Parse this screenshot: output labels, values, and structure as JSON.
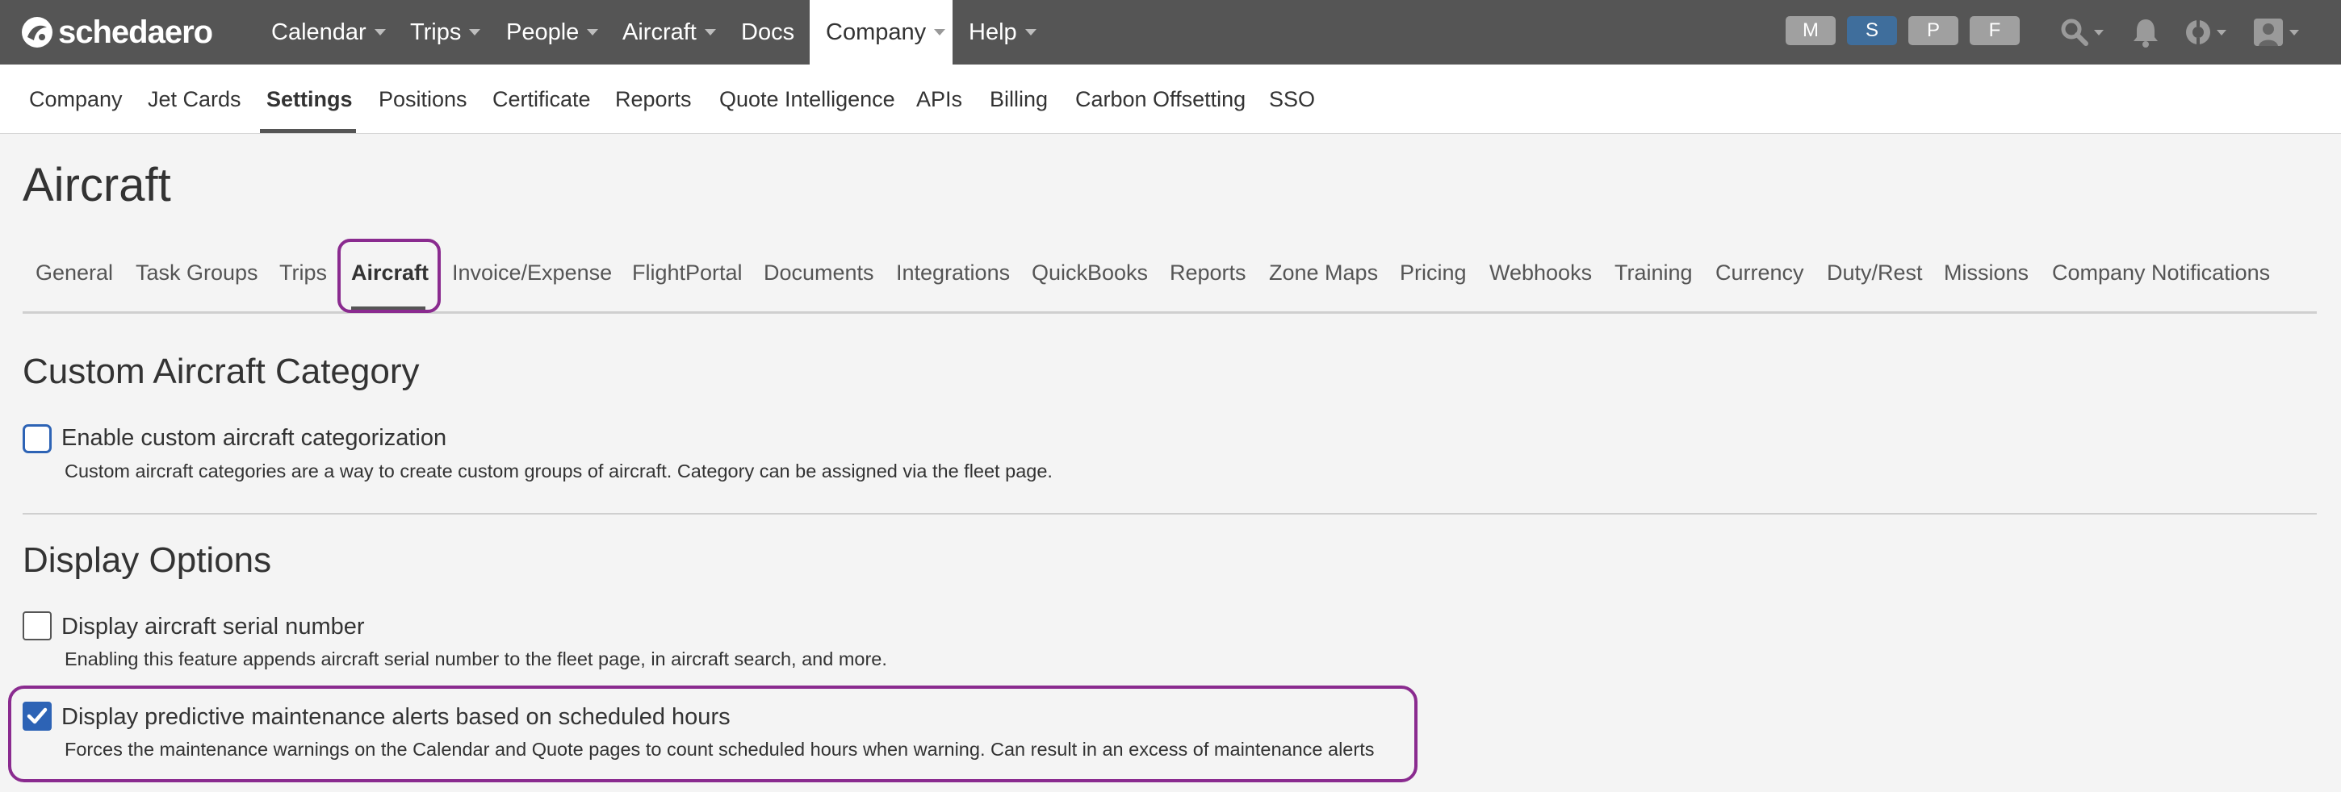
{
  "brand": {
    "name": "schedaero"
  },
  "topnav": {
    "items": [
      {
        "label": "Calendar",
        "has_caret": true
      },
      {
        "label": "Trips",
        "has_caret": true
      },
      {
        "label": "People",
        "has_caret": true
      },
      {
        "label": "Aircraft",
        "has_caret": true
      },
      {
        "label": "Docs",
        "has_caret": false
      },
      {
        "label": "Company",
        "has_caret": true,
        "active": true
      },
      {
        "label": "Help",
        "has_caret": true
      }
    ],
    "badges": [
      {
        "label": "M",
        "color": "#a0a0a0"
      },
      {
        "label": "S",
        "color": "#3f6e9c"
      },
      {
        "label": "P",
        "color": "#a0a0a0"
      },
      {
        "label": "F",
        "color": "#a0a0a0"
      }
    ],
    "tools": [
      "search-icon",
      "bell-icon",
      "help-icon",
      "user-icon"
    ]
  },
  "subnav": {
    "items": [
      "Company",
      "Jet Cards",
      "Settings",
      "Positions",
      "Certificate",
      "Reports",
      "Quote Intelligence",
      "APIs",
      "Billing",
      "Carbon Offsetting",
      "SSO"
    ],
    "active": "Settings"
  },
  "page": {
    "title": "Aircraft"
  },
  "tabs": {
    "items": [
      "General",
      "Task Groups",
      "Trips",
      "Aircraft",
      "Invoice/Expense",
      "FlightPortal",
      "Documents",
      "Integrations",
      "QuickBooks",
      "Reports",
      "Zone Maps",
      "Pricing",
      "Webhooks",
      "Training",
      "Currency",
      "Duty/Rest",
      "Missions",
      "Company Notifications"
    ],
    "active": "Aircraft"
  },
  "sections": {
    "custom_category": {
      "title": "Custom Aircraft Category",
      "options": [
        {
          "label": "Enable custom aircraft categorization",
          "description": "Custom aircraft categories are a way to create custom groups of aircraft. Category can be assigned via the fleet page.",
          "checked": false
        }
      ]
    },
    "display_options": {
      "title": "Display Options",
      "options": [
        {
          "label": "Display aircraft serial number",
          "description": "Enabling this feature appends aircraft serial number to the fleet page, in aircraft search, and more.",
          "checked": false
        },
        {
          "label": "Display predictive maintenance alerts based on scheduled hours",
          "description": "Forces the maintenance warnings on the Calendar and Quote pages to count scheduled hours when warning. Can result in an excess of maintenance alerts",
          "checked": true
        }
      ]
    }
  },
  "colors": {
    "accent": "#2d63b5",
    "highlight": "#8a2b8f",
    "topbar": "#555555"
  }
}
